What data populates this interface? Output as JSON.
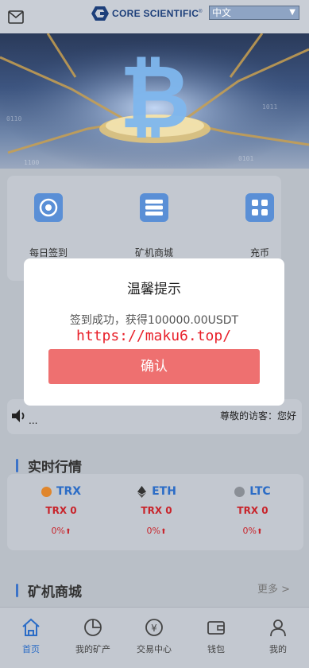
{
  "header": {
    "mail_icon": "mail-icon",
    "logo_text": "CORE SCIENTIFIC",
    "logo_mark": "®",
    "language": "中文"
  },
  "quick_menu": [
    {
      "label": "每日签到",
      "icon": "calendar-checkin-icon"
    },
    {
      "label": "矿机商城",
      "icon": "server-rack-icon"
    },
    {
      "label": "充币",
      "icon": "calculator-icon"
    }
  ],
  "notice": {
    "icon": "speaker-icon",
    "text": "尊敬的访客：您好",
    "ellipsis": "..."
  },
  "sections": {
    "market_title": "实时行情",
    "miner_title": "矿机商城",
    "more": "更多  >"
  },
  "market": [
    {
      "name": "TRX",
      "price": "TRX 0",
      "change": "0%",
      "icon_color": "#e0862c"
    },
    {
      "name": "ETH",
      "price": "TRX 0",
      "change": "0%",
      "icon_color": "#333333"
    },
    {
      "name": "LTC",
      "price": "TRX 0",
      "change": "0%",
      "icon_color": "#8a8f96"
    }
  ],
  "tabbar": [
    {
      "label": "首页",
      "icon": "home-icon",
      "active": true
    },
    {
      "label": "我的矿产",
      "icon": "pie-chart-icon",
      "active": false
    },
    {
      "label": "交易中心",
      "icon": "yen-exchange-icon",
      "active": false
    },
    {
      "label": "钱包",
      "icon": "wallet-icon",
      "active": false
    },
    {
      "label": "我的",
      "icon": "user-icon",
      "active": false
    }
  ],
  "modal": {
    "title": "温馨提示",
    "message": "签到成功，获得100000.00USDT",
    "watermark": "https://maku6.top/",
    "confirm": "确认"
  },
  "colors": {
    "accent": "#2b6cc6",
    "price_red": "#c8242b",
    "confirm_button": "#ee7070"
  }
}
